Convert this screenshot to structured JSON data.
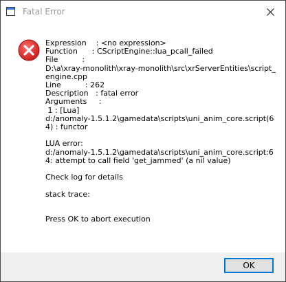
{
  "window": {
    "title": "Fatal Error"
  },
  "icons": {
    "app": "app-window-icon",
    "close": "close-icon",
    "error": "error-icon"
  },
  "colors": {
    "error_red": "#d32323",
    "accent": "#0078d7",
    "footer_bg": "#f0f0f0"
  },
  "message": {
    "text": "Expression    : <no expression>\nFunction      : CScriptEngine::lua_pcall_failed\nFile          :\nD:\\a\\xray-monolith\\xray-monolith\\src\\xrServerEntities\\script_engine.cpp\nLine          : 262\nDescription   : fatal error\nArguments     :\n 1 : [Lua]\nd:/anomaly-1.5.1.2\\gamedata\\scripts\\uni_anim_core.script(64) : functor\n\nLUA error:\nd:/anomaly-1.5.1.2\\gamedata\\scripts\\uni_anim_core.script:64: attempt to call field 'get_jammed' (a nil value)\n\nCheck log for details\n\nstack trace:\n\n\nPress OK to abort execution"
  },
  "buttons": {
    "ok": "OK"
  }
}
